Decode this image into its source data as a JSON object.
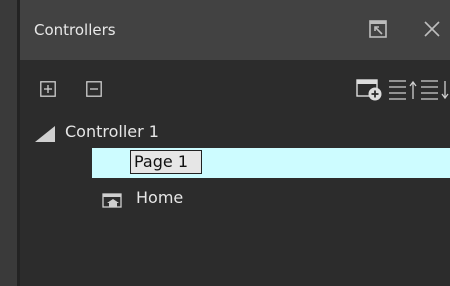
{
  "panel": {
    "title": "Controllers",
    "float_button": {
      "icon": "float-window-icon"
    },
    "close_button": {
      "icon": "close-icon"
    }
  },
  "toolbar": {
    "buttons": [
      {
        "id": "expand",
        "icon": "expand-all-icon"
      },
      {
        "id": "collapse",
        "icon": "collapse-all-icon"
      },
      {
        "id": "add-page",
        "icon": "add-page-icon"
      },
      {
        "id": "move-up",
        "icon": "move-up-icon"
      },
      {
        "id": "move-down",
        "icon": "move-down-icon"
      }
    ]
  },
  "tree": {
    "controller": {
      "label": "Controller 1",
      "expanded": true,
      "children": [
        {
          "label": "Page 1",
          "selected": true,
          "editing": true
        },
        {
          "label": "Home",
          "icon": "home-page-icon"
        }
      ]
    }
  },
  "colors": {
    "titlebar_bg": "#424242",
    "panel_bg": "#2c2c2c",
    "selection_bg": "#cdfcff",
    "text": "#e6e6e6"
  }
}
